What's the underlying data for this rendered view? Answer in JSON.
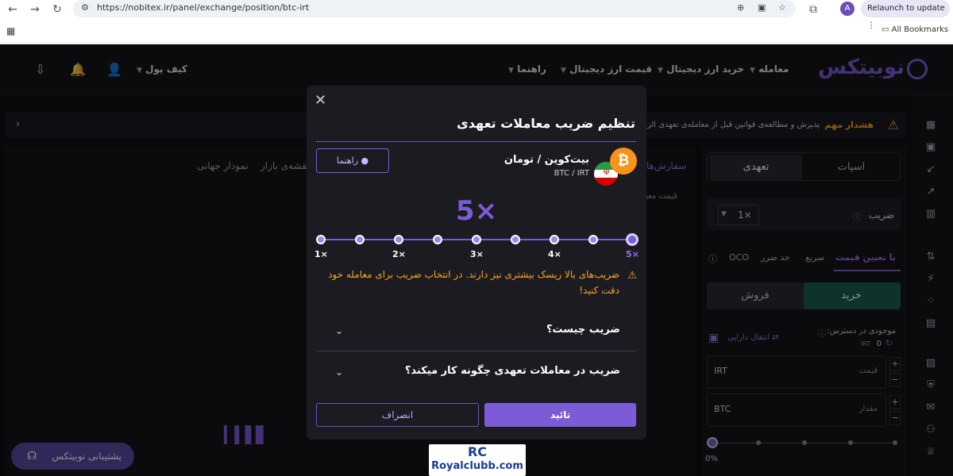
{
  "browser": {
    "url": "https://nobitex.ir/panel/exchange/position/btc-irt",
    "relaunch_label": "Relaunch to update",
    "avatar_letter": "A",
    "bookmarks_label": "All Bookmarks"
  },
  "header": {
    "logo_text": "نوبیتکس",
    "nav": [
      "معامله",
      "خرید ارز دیجیتال",
      "قیمت ارز دیجیتال",
      "راهنما"
    ],
    "wallet_label": "کیف پول"
  },
  "warning": {
    "title": "هشدار مهم",
    "text": "پذیرش و مطالعه‌ی قوانین قبل از معامله‌ی تعهدی الزا"
  },
  "chart_panel": {
    "tabs": [
      "نمودار جهانی",
      "نقشه‌ی بازار"
    ],
    "orders_tab": "سفارش‌ها",
    "price_label": "قیمت معیا"
  },
  "order_panel": {
    "spot_label": "اسپات",
    "margin_label": "تعهدی",
    "leverage_label": "ضریب",
    "leverage_value": "1×",
    "tabs": [
      "با تعیین قیمت",
      "سریع",
      "حد ضرر",
      "OCO"
    ],
    "buy_label": "خرید",
    "sell_label": "فروش",
    "balance_label": "موجودی در دسترس:",
    "balance_value": "0",
    "balance_unit": "IRT",
    "transfer_label": "انتقال دارایی",
    "price_field_label": "قیمت",
    "price_field_unit": "IRT",
    "amount_field_label": "مقدار",
    "amount_field_unit": "BTC",
    "percent_value": "0%"
  },
  "support_label": "پشتیبانی نوبیتکس",
  "watermark": {
    "logo": "RC",
    "text": "Royalclubb.com"
  },
  "modal": {
    "title": "تنظیم ضریب معاملات تعهدی",
    "guide_label": "راهنما",
    "pair_name": "بیت‌کوین / تومان",
    "pair_symbol": "BTC / IRT",
    "leverage_display": "5×",
    "leverage_selected": 5,
    "levels": [
      "1×",
      "2×",
      "3×",
      "4×",
      "5×"
    ],
    "warning_text": "ضریب‌های بالا ریسک بیشتری نیز دارند. در انتخاب ضریب برای معامله خود دقت کنید!",
    "faq": [
      "ضریب چیست؟",
      "ضریب در معاملات تعهدی چگونه کار میکند؟"
    ],
    "confirm_label": "تائید",
    "cancel_label": "انصراف"
  },
  "colors": {
    "accent": "#7c5cd6",
    "warning": "#f5a623",
    "buy": "#1a5c50",
    "bg": "#0f0f14"
  }
}
